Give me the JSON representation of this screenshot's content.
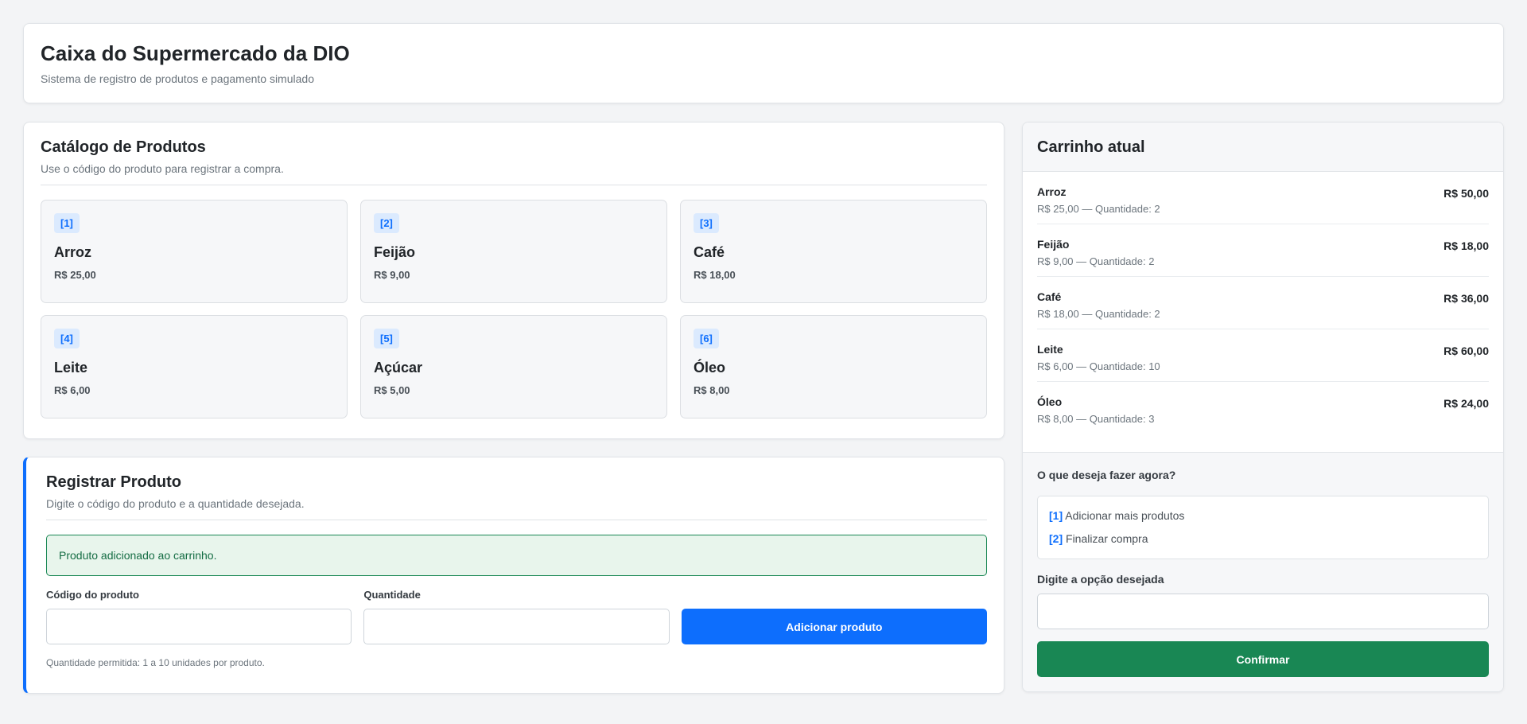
{
  "header": {
    "title": "Caixa do Supermercado da DIO",
    "subtitle": "Sistema de registro de produtos e pagamento simulado"
  },
  "catalog": {
    "title": "Catálogo de Produtos",
    "subtitle": "Use o código do produto para registrar a compra.",
    "products": [
      {
        "code": "[1]",
        "name": "Arroz",
        "price": "R$ 25,00"
      },
      {
        "code": "[2]",
        "name": "Feijão",
        "price": "R$ 9,00"
      },
      {
        "code": "[3]",
        "name": "Café",
        "price": "R$ 18,00"
      },
      {
        "code": "[4]",
        "name": "Leite",
        "price": "R$ 6,00"
      },
      {
        "code": "[5]",
        "name": "Açúcar",
        "price": "R$ 5,00"
      },
      {
        "code": "[6]",
        "name": "Óleo",
        "price": "R$ 8,00"
      }
    ]
  },
  "register": {
    "title": "Registrar Produto",
    "subtitle": "Digite o código do produto e a quantidade desejada.",
    "alert": "Produto adicionado ao carrinho.",
    "code_label": "Código do produto",
    "code_value": "",
    "qty_label": "Quantidade",
    "qty_value": "",
    "button": "Adicionar produto",
    "hint": "Quantidade permitida: 1 a 10 unidades por produto."
  },
  "cart": {
    "title": "Carrinho atual",
    "items": [
      {
        "name": "Arroz",
        "detail": "R$ 25,00 — Quantidade: 2",
        "total": "R$ 50,00"
      },
      {
        "name": "Feijão",
        "detail": "R$ 9,00 — Quantidade: 2",
        "total": "R$ 18,00"
      },
      {
        "name": "Café",
        "detail": "R$ 18,00 — Quantidade: 2",
        "total": "R$ 36,00"
      },
      {
        "name": "Leite",
        "detail": "R$ 6,00 — Quantidade: 10",
        "total": "R$ 60,00"
      },
      {
        "name": "Óleo",
        "detail": "R$ 8,00 — Quantidade: 3",
        "total": "R$ 24,00"
      }
    ],
    "actions_title": "O que deseja fazer agora?",
    "options": [
      {
        "num": "[1]",
        "label": "Adicionar mais produtos"
      },
      {
        "num": "[2]",
        "label": "Finalizar compra"
      }
    ],
    "option_label": "Digite a opção desejada",
    "option_value": "",
    "confirm": "Confirmar"
  },
  "colors": {
    "primary": "#0d6efd",
    "success": "#198754",
    "background": "#f3f4f6"
  }
}
